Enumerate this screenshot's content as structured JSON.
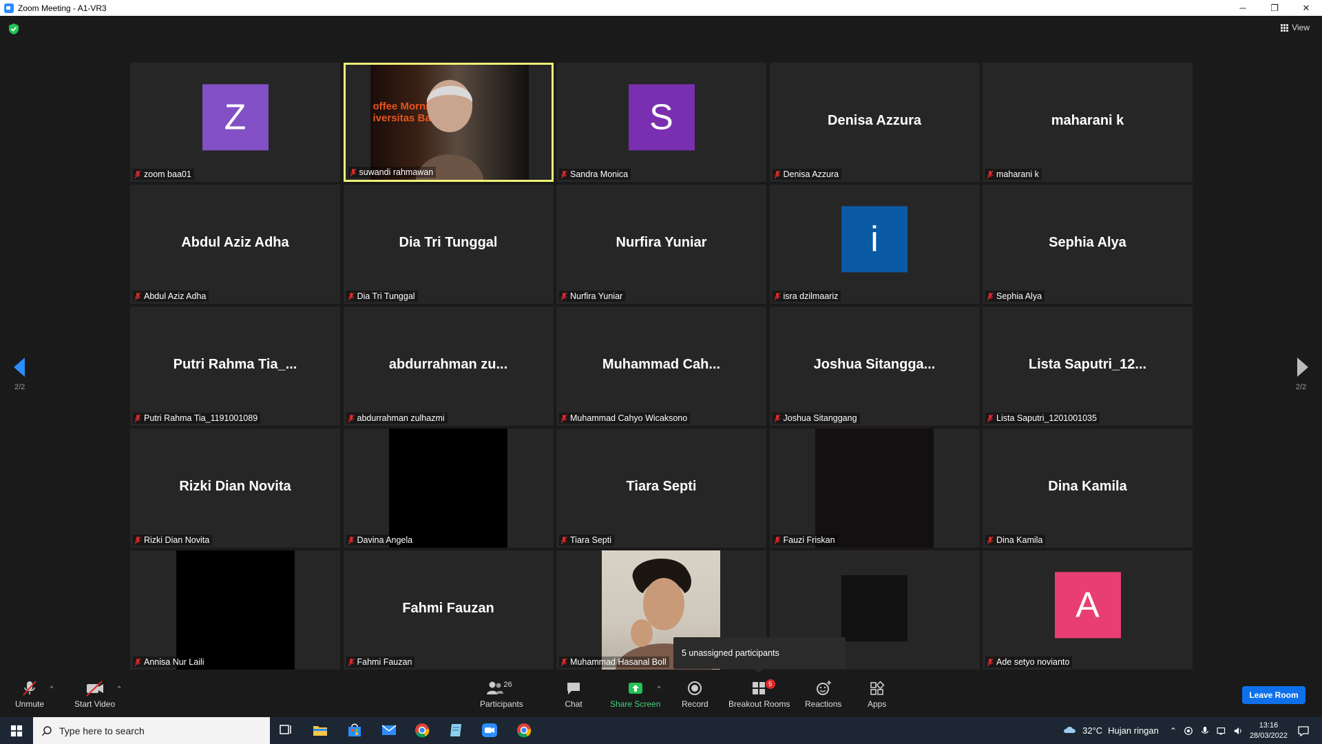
{
  "window": {
    "title": "Zoom Meeting - A1-VR3",
    "minimize": "─",
    "restore": "❐",
    "close": "✕"
  },
  "view_button": {
    "label": "View"
  },
  "pager": {
    "left_page": "2/2",
    "right_page": "2/2"
  },
  "colors": {
    "active_border": "#f1f379",
    "avatar_z": "#8250c4",
    "avatar_s": "#7a2fb0",
    "avatar_i": "#0b5aa6",
    "avatar_a": "#e83e73",
    "leave": "#0e71eb",
    "share": "#3fd477"
  },
  "tiles": [
    {
      "display": "avatar",
      "avatar_letter": "Z",
      "avatar_color": "#8250c4",
      "name": "zoom baa01"
    },
    {
      "display": "video",
      "name": "suwandi rahmawan",
      "active": true,
      "slide_text": "offee Morni\niversitas Ba"
    },
    {
      "display": "avatar",
      "avatar_letter": "S",
      "avatar_color": "#7a2fb0",
      "name": "Sandra Monica"
    },
    {
      "display": "name",
      "big_name": "Denisa Azzura",
      "name": "Denisa Azzura"
    },
    {
      "display": "name",
      "big_name": "maharani k",
      "name": "maharani k"
    },
    {
      "display": "name",
      "big_name": "Abdul Aziz Adha",
      "name": "Abdul Aziz Adha"
    },
    {
      "display": "name",
      "big_name": "Dia Tri Tunggal",
      "name": "Dia Tri Tunggal"
    },
    {
      "display": "name",
      "big_name": "Nurfira Yuniar",
      "name": "Nurfira Yuniar"
    },
    {
      "display": "avatar",
      "avatar_letter": "i",
      "avatar_color": "#0b5aa6",
      "name": "isra dzilmaariz"
    },
    {
      "display": "name",
      "big_name": "Sephia Alya",
      "name": "Sephia Alya"
    },
    {
      "display": "name",
      "big_name": "Putri  Rahma  Tia_...",
      "name": "Putri Rahma Tia_1191001089"
    },
    {
      "display": "name",
      "big_name": "abdurrahman  zu...",
      "name": "abdurrahman zulhazmi"
    },
    {
      "display": "name",
      "big_name": "Muhammad  Cah...",
      "name": "Muhammad Cahyo Wicaksono"
    },
    {
      "display": "name",
      "big_name": "Joshua  Sitangga...",
      "name": "Joshua Sitanggang"
    },
    {
      "display": "name",
      "big_name": "Lista  Saputri_12...",
      "name": "Lista Saputri_1201001035"
    },
    {
      "display": "name",
      "big_name": "Rizki Dian Novita",
      "name": "Rizki Dian Novita"
    },
    {
      "display": "black",
      "name": "Davina Angela"
    },
    {
      "display": "name",
      "big_name": "Tiara Septi",
      "name": "Tiara Septi"
    },
    {
      "display": "dark",
      "name": "Fauzi Friskan"
    },
    {
      "display": "name",
      "big_name": "Dina Kamila",
      "name": "Dina Kamila"
    },
    {
      "display": "black",
      "name": "Annisa Nur Laili"
    },
    {
      "display": "name",
      "big_name": "Fahmi Fauzan",
      "name": "Fahmi Fauzan"
    },
    {
      "display": "photo",
      "name": "Muhammad Hasanal Boll"
    },
    {
      "display": "small",
      "name": ""
    },
    {
      "display": "avatar",
      "avatar_letter": "A",
      "avatar_color": "#e83e73",
      "name": "Ade setyo novianto"
    }
  ],
  "popup": {
    "text": "5 unassigned participants"
  },
  "toolbar": {
    "unmute": "Unmute",
    "start_video": "Start Video",
    "participants": "Participants",
    "participants_count": "26",
    "chat": "Chat",
    "share_screen": "Share Screen",
    "record": "Record",
    "breakout_rooms": "Breakout Rooms",
    "breakout_badge": "5",
    "reactions": "Reactions",
    "apps": "Apps",
    "leave": "Leave Room"
  },
  "taskbar": {
    "search_placeholder": "Type here to search",
    "weather_temp": "32°C",
    "weather_text": "Hujan ringan",
    "time": "13:16",
    "date": "28/03/2022"
  }
}
